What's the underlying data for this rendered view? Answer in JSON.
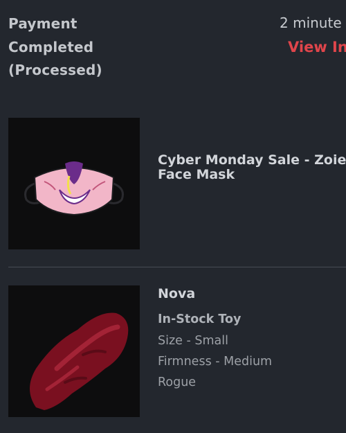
{
  "order": {
    "status_label": "Payment Completed (Processed)",
    "time_ago": "2 minute",
    "view_link": "View In"
  },
  "items": [
    {
      "title_line1": "Cyber Monday Sale - Zoie",
      "title_line2": "Face Mask",
      "thumbnail_icon": "face-mask-product-image"
    },
    {
      "title": "Nova",
      "subtitle": "In-Stock Toy",
      "options": [
        "Size - Small",
        "Firmness - Medium",
        "Rogue"
      ],
      "thumbnail_icon": "toy-product-image"
    }
  ],
  "colors": {
    "background": "#23272e",
    "accent": "#e0454b",
    "divider": "#474c55"
  }
}
